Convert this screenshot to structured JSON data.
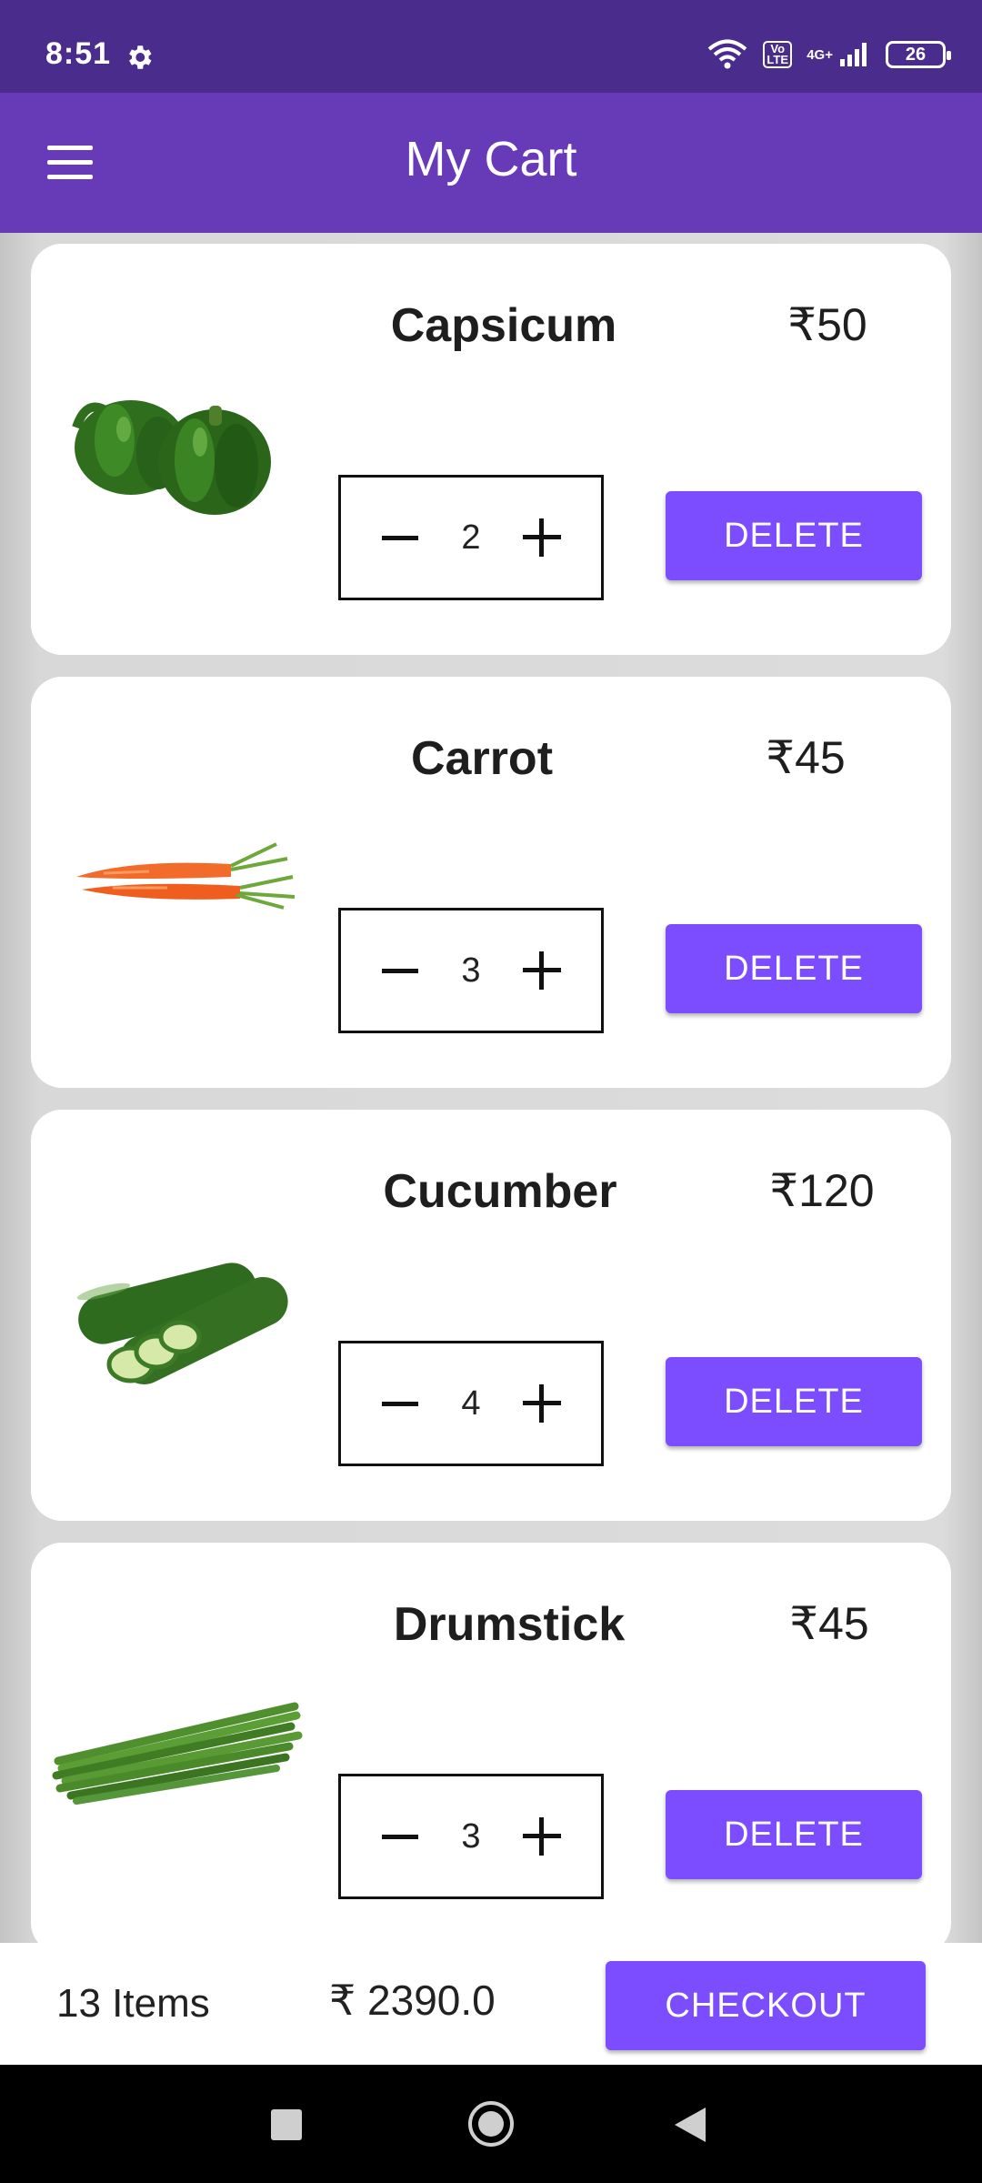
{
  "status_bar": {
    "time": "8:51",
    "network_label": "4G+",
    "volte_label": "Vo LTE",
    "battery": "26"
  },
  "app_bar": {
    "title": "My Cart"
  },
  "cart": {
    "items": [
      {
        "name": "Capsicum",
        "price": "₹50",
        "quantity": "2",
        "delete_label": "DELETE",
        "image_icon": "capsicum-image"
      },
      {
        "name": "Carrot",
        "price": "₹45",
        "quantity": "3",
        "delete_label": "DELETE",
        "image_icon": "carrot-image"
      },
      {
        "name": "Cucumber",
        "price": "₹120",
        "quantity": "4",
        "delete_label": "DELETE",
        "image_icon": "cucumber-image"
      },
      {
        "name": "Drumstick",
        "price": "₹45",
        "quantity": "3",
        "delete_label": "DELETE",
        "image_icon": "drumstick-image"
      }
    ]
  },
  "footer": {
    "items_count": "13 Items",
    "total": "₹ 2390.0",
    "checkout_label": "CHECKOUT"
  },
  "colors": {
    "status_bar": "#4a2c8c",
    "app_bar": "#673ab7",
    "accent_button": "#7c4dff"
  }
}
